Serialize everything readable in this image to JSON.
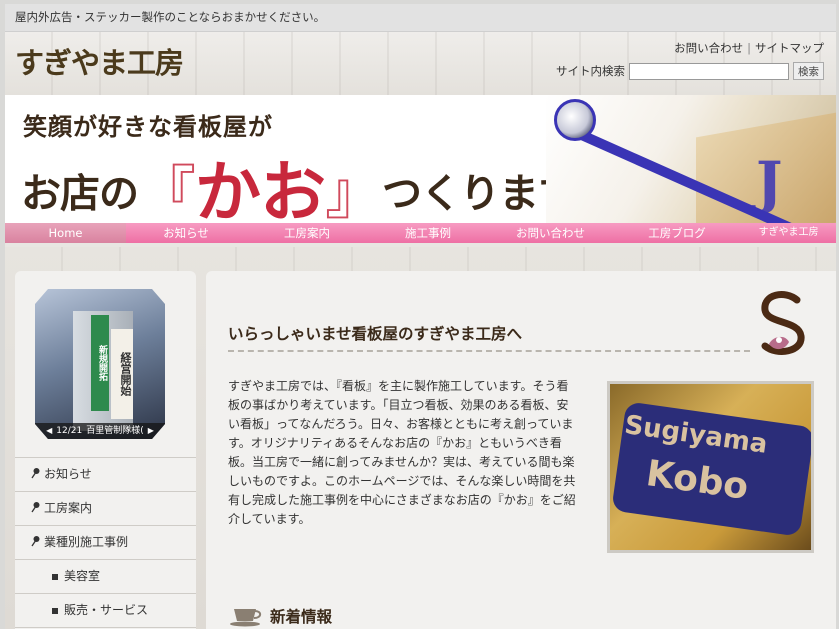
{
  "topbar": {
    "notice": "屋内外広告・ステッカー製作のことならおまかせください。"
  },
  "header": {
    "logo": "すぎやま工房",
    "links": [
      "お問い合わせ",
      "サイトマップ"
    ],
    "search_label": "サイト内検索",
    "search_placeholder": "",
    "search_button": "検索"
  },
  "hero": {
    "line1": "笑顔が好きな看板屋が",
    "line2_pre": "お店の",
    "line2_open": "『",
    "line2_kao": "かお",
    "line2_close": "』",
    "line2_post": "つくります。"
  },
  "nav": {
    "items": [
      {
        "label": "Home"
      },
      {
        "label": "お知らせ"
      },
      {
        "label": "工房案内"
      },
      {
        "label": "施工事例"
      },
      {
        "label": "お問い合わせ"
      },
      {
        "label": "工房ブログ"
      },
      {
        "label": "すぎやま工房"
      }
    ],
    "active": "Home"
  },
  "slideshow": {
    "caption_date": "12/21",
    "caption_text": "百里管制隊様(",
    "banner1": "新規開拓",
    "banner2": "経営開始"
  },
  "sidebar": {
    "items": [
      {
        "label": "お知らせ"
      },
      {
        "label": "工房案内"
      },
      {
        "label": "業種別施工事例"
      },
      {
        "label": "美容室"
      },
      {
        "label": "販売・サービス"
      }
    ]
  },
  "main": {
    "title": "いらっしゃいませ看板屋のすぎやま工房へ",
    "intro": "すぎやま工房では、『看板』を主に製作施工しています。そう看板の事ばかり考えています。「目立つ看板、効果のある看板、安い看板」ってなんだろう。日々、お客様とともに考え創っています。オリジナリティあるそんなお店の『かお』ともいうべき看板。当工房で一緒に創ってみませんか？実は、考えている間も楽しいものですよ。このホームページでは、そんな楽しい時間を共有し完成した施工事例を中心にさまざまなお店の『かお』をご紹介しています。",
    "photo_text1": "Sugiyama",
    "photo_text2": "Kobo",
    "news_title": "新着情報"
  }
}
